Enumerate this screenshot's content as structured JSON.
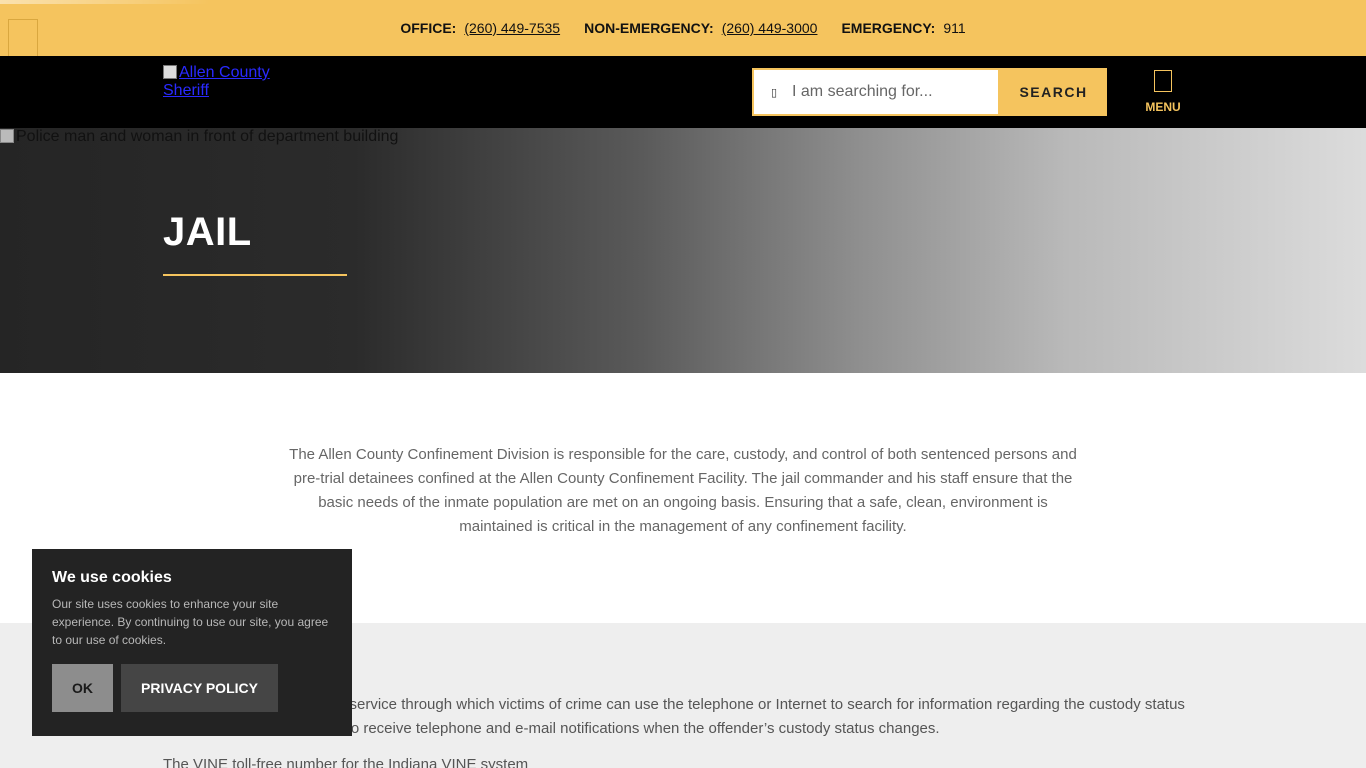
{
  "topbar": {
    "contacts": [
      {
        "label": "OFFICE:",
        "value": "(260) 449-7535"
      },
      {
        "label": "NON-EMERGENCY:",
        "value": "(260) 449-3000"
      },
      {
        "label": "EMERGENCY:",
        "value": "911"
      }
    ]
  },
  "header": {
    "logo_alt": "Allen County Sheriff",
    "search": {
      "placeholder": "I am searching for...",
      "button_label": "SEARCH",
      "icon": "search-icon"
    },
    "menu_label": "MENU"
  },
  "hero": {
    "image_alt": "Police man and woman in front of department building",
    "title": "JAIL"
  },
  "intro": {
    "text": "The Allen County Confinement Division is responsible for the care, custody, and control of both sentenced persons and pre-trial detainees confined at the Allen County Confinement Facility. The jail commander and his staff ensure that the basic needs of the inmate population are met on an ongoing basis. Ensuring that a safe, clean, environment is maintained is critical in the management of any confinement facility."
  },
  "vine": {
    "text_visible": "a service through which victims of crime can use the telephone or Internet to search for information regarding the custody status",
    "text_line2": "ter to receive telephone and e-mail notifications when the offender’s custody status changes.",
    "phone_line": "The VINE toll-free number for the Indiana VINE system"
  },
  "cookie": {
    "title": "We use cookies",
    "text": "Our site uses cookies to enhance your site experience. By continuing to use our site, you agree to our use of cookies.",
    "ok_label": "OK",
    "policy_label": "PRIVACY POLICY"
  },
  "colors": {
    "accent": "#f5c45e",
    "header_bg": "#000000",
    "banner_bg": "#232323"
  }
}
